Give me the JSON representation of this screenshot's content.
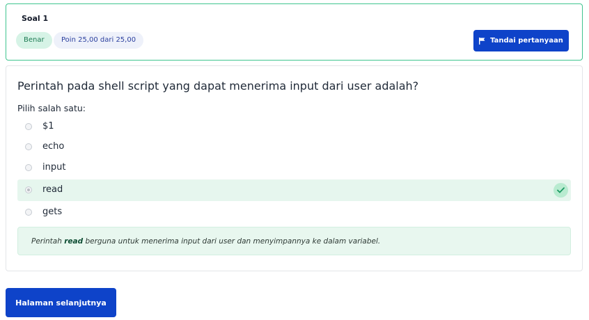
{
  "question_info": {
    "title": "Soal 1",
    "status": "Benar",
    "points": "Poin 25,00 dari 25,00",
    "flag_button": "Tandai pertanyaan"
  },
  "question": {
    "text": "Perintah pada shell script yang dapat menerima input dari user adalah?",
    "choose_label": "Pilih salah satu:",
    "options": [
      {
        "label": "$1",
        "selected": false,
        "correct": false
      },
      {
        "label": "echo",
        "selected": false,
        "correct": false
      },
      {
        "label": "input",
        "selected": false,
        "correct": false
      },
      {
        "label": "read",
        "selected": true,
        "correct": true
      },
      {
        "label": "gets",
        "selected": false,
        "correct": false
      }
    ],
    "feedback": {
      "prefix": "Perintah ",
      "keyword": "read",
      "suffix": " berguna untuk menerima input dari user dan menyimpannya ke dalam variabel."
    }
  },
  "footer": {
    "next_button": "Halaman selanjutnya"
  },
  "colors": {
    "primary": "#0e43c9",
    "correct_border": "#3ec48e",
    "correct_bg": "#e6f6ee",
    "status_badge_bg": "#d6f3e6",
    "points_badge_bg": "#eef1fa"
  },
  "icons": {
    "flag": "flag-icon",
    "check": "check-icon"
  }
}
